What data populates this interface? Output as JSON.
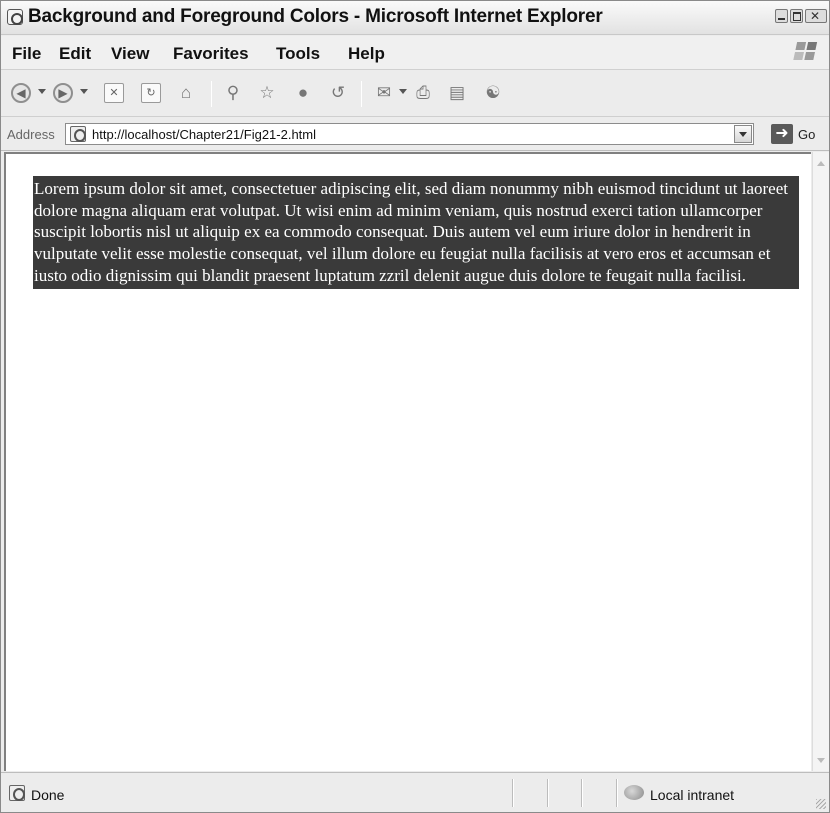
{
  "window": {
    "title": "Background and Foreground Colors - Microsoft Internet Explorer"
  },
  "menu": [
    "File",
    "Edit",
    "View",
    "Favorites",
    "Tools",
    "Help"
  ],
  "toolbar": {
    "buttons": [
      "back-icon",
      "forward-icon",
      "stop-icon",
      "refresh-icon",
      "home-icon",
      "search-icon",
      "favorites-icon",
      "media-icon",
      "history-icon",
      "mail-icon",
      "print-icon",
      "edit-icon",
      "messenger-icon"
    ]
  },
  "address": {
    "label": "Address",
    "url": "http://localhost/Chapter21/Fig21-2.html",
    "go_label": "Go"
  },
  "content": {
    "paragraph": "Lorem ipsum dolor sit amet, consectetuer adipiscing elit, sed diam nonummy nibh euismod tincidunt ut laoreet dolore magna aliquam erat volutpat. Ut wisi enim ad minim veniam, quis nostrud exerci tation ullamcorper suscipit lobortis nisl ut aliquip ex ea commodo consequat. Duis autem vel eum iriure dolor in hendrerit in vulputate velit esse molestie consequat, vel illum dolore eu feugiat nulla facilisis at vero eros et accumsan et iusto odio dignissim qui blandit praesent luptatum zzril delenit augue duis dolore te feugait nulla facilisi.",
    "paragraph_background": "#3a3a3a",
    "paragraph_color": "#ffffff"
  },
  "status": {
    "text": "Done",
    "zone": "Local intranet"
  }
}
